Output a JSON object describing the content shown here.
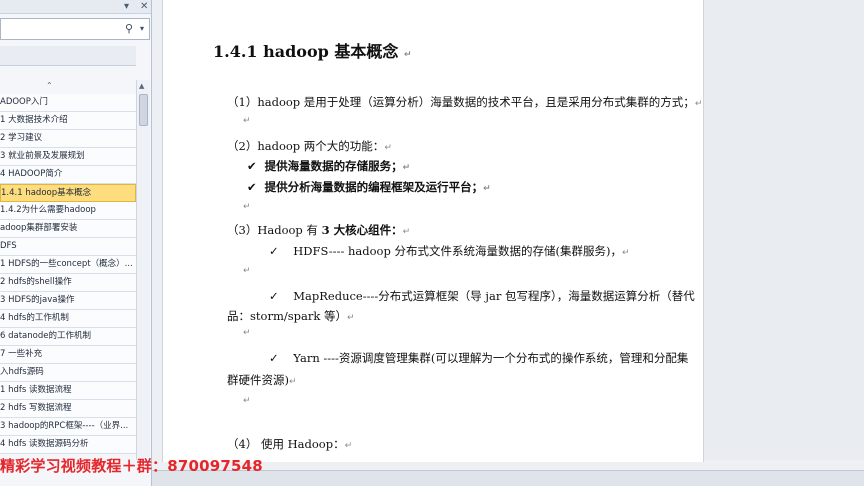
{
  "navigation_pane": {
    "search": {
      "value": "",
      "placeholder": ""
    },
    "items": [
      {
        "label": "ADOOP入门",
        "active": false
      },
      {
        "label": "1 大数据技术介绍",
        "active": false
      },
      {
        "label": "2 学习建议",
        "active": false
      },
      {
        "label": "3 就业前景及发展规划",
        "active": false
      },
      {
        "label": "4  HADOOP简介",
        "active": false
      },
      {
        "label": "1.4.1  hadoop基本概念",
        "active": true
      },
      {
        "label": "1.4.2为什么需要hadoop",
        "active": false
      },
      {
        "label": "adoop集群部署安装",
        "active": false
      },
      {
        "label": "DFS",
        "active": false
      },
      {
        "label": "1  HDFS的一些concept（概念）...",
        "active": false
      },
      {
        "label": "2  hdfs的shell操作",
        "active": false
      },
      {
        "label": "3  HDFS的java操作",
        "active": false
      },
      {
        "label": "4  hdfs的工作机制",
        "active": false
      },
      {
        "label": "6  datanode的工作机制",
        "active": false
      },
      {
        "label": "7 一些补充",
        "active": false
      },
      {
        "label": "入hdfs源码",
        "active": false
      },
      {
        "label": "1 hdfs 读数据流程",
        "active": false
      },
      {
        "label": "2 hdfs 写数据流程",
        "active": false
      },
      {
        "label": "3 hadoop的RPC框架----（业界...",
        "active": false
      },
      {
        "label": "4 hdfs 读数据源码分析",
        "active": false
      }
    ]
  },
  "document": {
    "heading": "1.4.1    hadoop 基本概念",
    "para1": "（1）hadoop 是用于处理（运算分析）海量数据的技术平台，且是采用分布式集群的方式；",
    "para2_title": "（2）hadoop 两个大的功能：",
    "para2_items": [
      "提供海量数据的存储服务；",
      "提供分析海量数据的编程框架及运行平台；"
    ],
    "para3_title_pre": "（3）Hadoop 有 ",
    "para3_title_bold": "3 大核心组件：",
    "hdfs_line": "HDFS---- hadoop 分布式文件系统海量数据的存储(集群服务)，",
    "mr_line1": "MapReduce----分布式运算框架（导 jar 包写程序），海量数据运算分析（替代",
    "mr_line2": "品：storm/spark 等）",
    "yarn_line1": "Yarn ----资源调度管理集群(可以理解为一个分布式的操作系统，管理和分配集",
    "yarn_line2": "群硬件资源)",
    "para4": "（4） 使用 Hadoop：",
    "check_symbol": "✔",
    "check_symbol_plain": "✓",
    "return_mark": "↵"
  },
  "watermark": "精彩学习视频教程＋群：870097548",
  "colors": {
    "active_item_bg": "#fddd7e",
    "watermark": "#e5262b",
    "nav_bg": "#f4f6f9"
  }
}
